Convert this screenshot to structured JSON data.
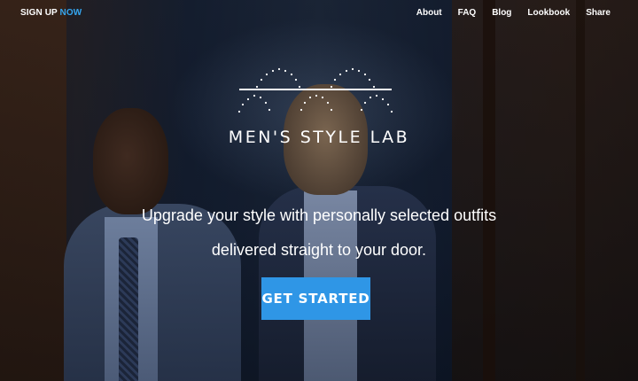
{
  "nav": {
    "signup_prefix": "SIGN UP",
    "signup_suffix": "NOW",
    "links": [
      "About",
      "FAQ",
      "Blog",
      "Lookbook",
      "Share"
    ]
  },
  "brand": {
    "name": "MEN'S STYLE LAB",
    "logo_icon": "dotted-arcs-logo-icon"
  },
  "hero": {
    "tagline_line1": "Upgrade your style with personally selected outfits",
    "tagline_line2": "delivered straight to your door.",
    "cta_label": "GET STARTED"
  },
  "colors": {
    "accent": "#2f96e6",
    "now_accent": "#35a6f0",
    "text": "#ffffff"
  }
}
